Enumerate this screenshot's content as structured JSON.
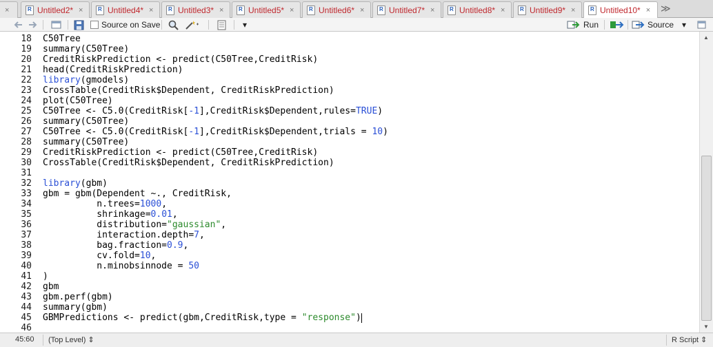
{
  "tabs": [
    {
      "label": "",
      "close": "×"
    },
    {
      "label": "Untitled2*",
      "close": "×"
    },
    {
      "label": "Untitled4*",
      "close": "×"
    },
    {
      "label": "Untitled3*",
      "close": "×"
    },
    {
      "label": "Untitled5*",
      "close": "×"
    },
    {
      "label": "Untitled6*",
      "close": "×"
    },
    {
      "label": "Untitled7*",
      "close": "×"
    },
    {
      "label": "Untitled8*",
      "close": "×"
    },
    {
      "label": "Untitled9*",
      "close": "×"
    },
    {
      "label": "Untitled10*",
      "close": "×"
    }
  ],
  "tab_overflow": "≫",
  "toolbar": {
    "source_on_save": "Source on Save",
    "run": "Run",
    "source": "Source",
    "dropdown": "▾"
  },
  "editor": {
    "lines": [
      {
        "n": "18",
        "html": "C50Tree"
      },
      {
        "n": "19",
        "html": "summary(C50Tree)"
      },
      {
        "n": "20",
        "html": "CreditRiskPrediction &lt;- predict(C50Tree,CreditRisk)"
      },
      {
        "n": "21",
        "html": "head(CreditRiskPrediction)"
      },
      {
        "n": "22",
        "html": "<span class=\"kw\">library</span>(gmodels)"
      },
      {
        "n": "23",
        "html": "CrossTable(CreditRisk$Dependent, CreditRiskPrediction)"
      },
      {
        "n": "24",
        "html": "plot(C50Tree)"
      },
      {
        "n": "25",
        "html": "C50Tree &lt;- C5.0(CreditRisk[<span class=\"num\">-1</span>],CreditRisk$Dependent,rules=<span class=\"kw\">TRUE</span>)"
      },
      {
        "n": "26",
        "html": "summary(C50Tree)"
      },
      {
        "n": "27",
        "html": "C50Tree &lt;- C5.0(CreditRisk[<span class=\"num\">-1</span>],CreditRisk$Dependent,trials = <span class=\"num\">10</span>)"
      },
      {
        "n": "28",
        "html": "summary(C50Tree)"
      },
      {
        "n": "29",
        "html": "CreditRiskPrediction &lt;- predict(C50Tree,CreditRisk)"
      },
      {
        "n": "30",
        "html": "CrossTable(CreditRisk$Dependent, CreditRiskPrediction)"
      },
      {
        "n": "31",
        "html": ""
      },
      {
        "n": "32",
        "html": "<span class=\"kw\">library</span>(gbm)"
      },
      {
        "n": "33",
        "html": "gbm = gbm(Dependent ~., CreditRisk,"
      },
      {
        "n": "34",
        "html": "          n.trees=<span class=\"num\">1000</span>,"
      },
      {
        "n": "35",
        "html": "          shrinkage=<span class=\"num\">0.01</span>,"
      },
      {
        "n": "36",
        "html": "          distribution=<span class=\"str\">\"gaussian\"</span>,"
      },
      {
        "n": "37",
        "html": "          interaction.depth=<span class=\"num\">7</span>,"
      },
      {
        "n": "38",
        "html": "          bag.fraction=<span class=\"num\">0.9</span>,"
      },
      {
        "n": "39",
        "html": "          cv.fold=<span class=\"num\">10</span>,"
      },
      {
        "n": "40",
        "html": "          n.minobsinnode = <span class=\"num\">50</span>"
      },
      {
        "n": "41",
        "html": ")"
      },
      {
        "n": "42",
        "html": "gbm"
      },
      {
        "n": "43",
        "html": "gbm.perf(gbm)"
      },
      {
        "n": "44",
        "html": "summary(gbm)"
      },
      {
        "n": "45",
        "html": "GBMPredictions &lt;- predict(gbm,CreditRisk,type = <span class=\"str\">\"response\"</span>)<span class=\"cursor\"></span>"
      },
      {
        "n": "46",
        "html": ""
      }
    ]
  },
  "status": {
    "position": "45:60",
    "scope": "(Top Level) ⇕",
    "filetype": "R Script ⇕"
  },
  "colors": {
    "tab_label": "#c0272d",
    "keyword": "#2a4fd6",
    "string": "#2c8a2c"
  }
}
